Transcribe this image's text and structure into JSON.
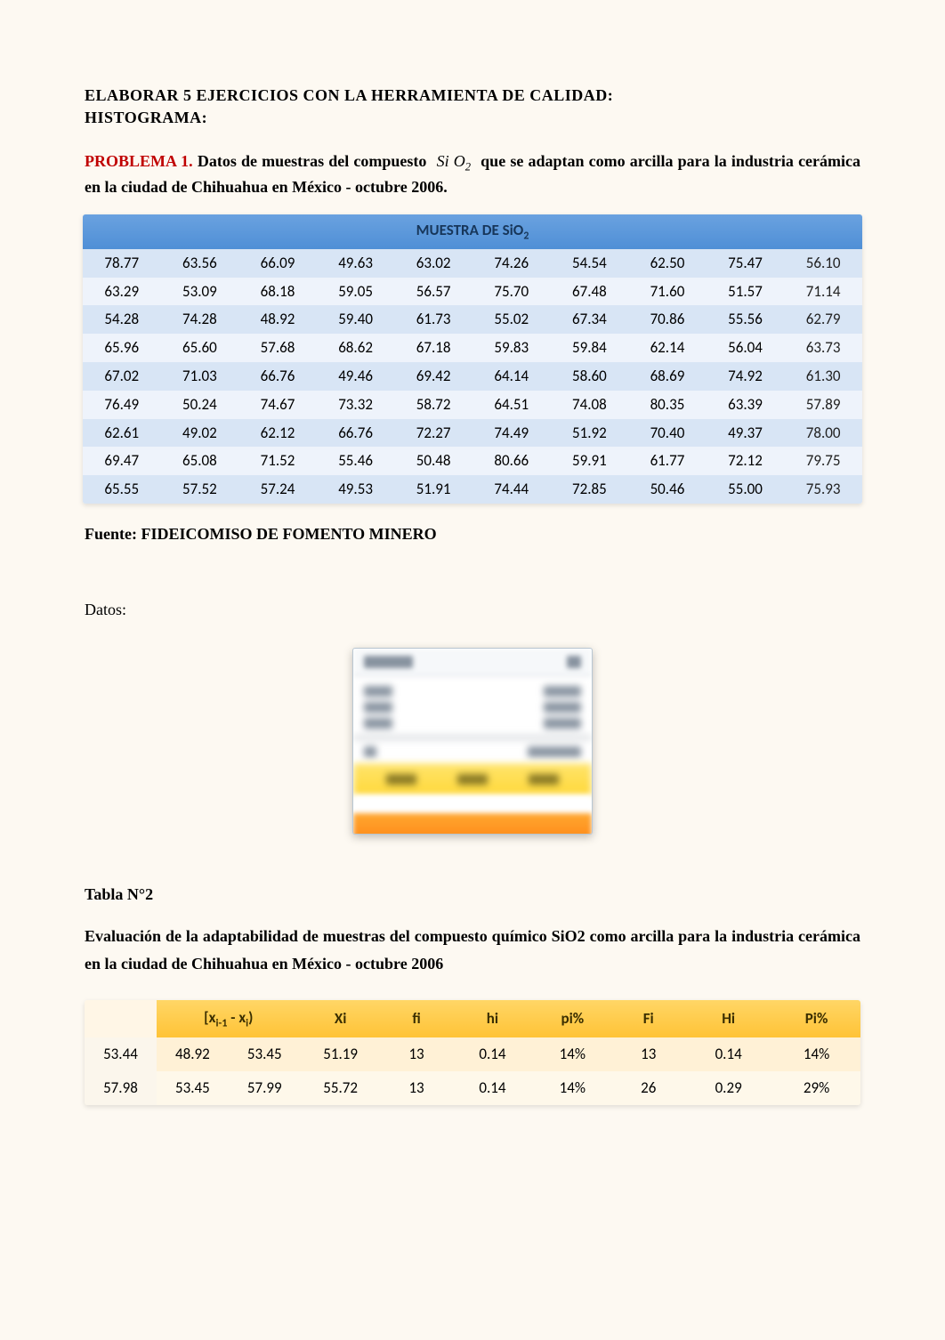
{
  "title_line1": "ELABORAR 5 EJERCICIOS CON LA HERRAMIENTA DE CALIDAD:",
  "title_line2": "HISTOGRAMA:",
  "problem_label": "PROBLEMA 1.",
  "problem_text_a": " Datos de muestras del compuesto ",
  "problem_formula": "Si O",
  "problem_formula_sub": "2",
  "problem_text_b": " que se adaptan como arcilla para la industria cerámica en la ciudad de Chihuahua en México - octubre 2006.",
  "table1_title_a": "MUESTRA DE SiO",
  "table1_title_sub": "2",
  "table1_rows": [
    [
      "78.77",
      "63.56",
      "66.09",
      "49.63",
      "63.02",
      "74.26",
      "54.54",
      "62.50",
      "75.47",
      "56.10"
    ],
    [
      "63.29",
      "53.09",
      "68.18",
      "59.05",
      "56.57",
      "75.70",
      "67.48",
      "71.60",
      "51.57",
      "71.14"
    ],
    [
      "54.28",
      "74.28",
      "48.92",
      "59.40",
      "61.73",
      "55.02",
      "67.34",
      "70.86",
      "55.56",
      "62.79"
    ],
    [
      "65.96",
      "65.60",
      "57.68",
      "68.62",
      "67.18",
      "59.83",
      "59.84",
      "62.14",
      "56.04",
      "63.73"
    ],
    [
      "67.02",
      "71.03",
      "66.76",
      "49.46",
      "69.42",
      "64.14",
      "58.60",
      "68.69",
      "74.92",
      "61.30"
    ],
    [
      "76.49",
      "50.24",
      "74.67",
      "73.32",
      "58.72",
      "64.51",
      "74.08",
      "80.35",
      "63.39",
      "57.89"
    ],
    [
      "62.61",
      "49.02",
      "62.12",
      "66.76",
      "72.27",
      "74.49",
      "51.92",
      "70.40",
      "49.37",
      "78.00"
    ],
    [
      "69.47",
      "65.08",
      "71.52",
      "55.46",
      "50.48",
      "80.66",
      "59.91",
      "61.77",
      "72.12",
      "79.75"
    ],
    [
      "65.55",
      "57.52",
      "57.24",
      "49.53",
      "51.91",
      "74.44",
      "72.85",
      "50.46",
      "55.00",
      "75.93"
    ]
  ],
  "source_label": "Fuente: FIDEICOMISO DE FOMENTO MINERO",
  "datos_label": "Datos:",
  "tabla_n2_label": "Tabla N°2",
  "eval_text": "Evaluación de la adaptabilidad de muestras del compuesto químico SiO2 como arcilla para la industria cerámica en la ciudad de Chihuahua en México - octubre 2006",
  "table2_headers": {
    "interval_l": "[x",
    "interval_lsub": "i-1",
    "interval_mid": " - x",
    "interval_rsub": "i",
    "interval_r": ")",
    "xi": "Xi",
    "fi": "fi",
    "hi": "hi",
    "pi": "pi%",
    "Fi": "Fi",
    "Hi": "Hi",
    "Pi": "Pi%"
  },
  "table2_rows": [
    {
      "lead": "53.44",
      "lo": "48.92",
      "hi": "53.45",
      "xi": "51.19",
      "fi": "13",
      "h": "0.14",
      "pi": "14%",
      "Fi": "13",
      "Hi": "0.14",
      "Pi": "14%"
    },
    {
      "lead": "57.98",
      "lo": "53.45",
      "hi": "57.99",
      "xi": "55.72",
      "fi": "13",
      "h": "0.14",
      "pi": "14%",
      "Fi": "26",
      "Hi": "0.29",
      "Pi": "29%"
    }
  ]
}
